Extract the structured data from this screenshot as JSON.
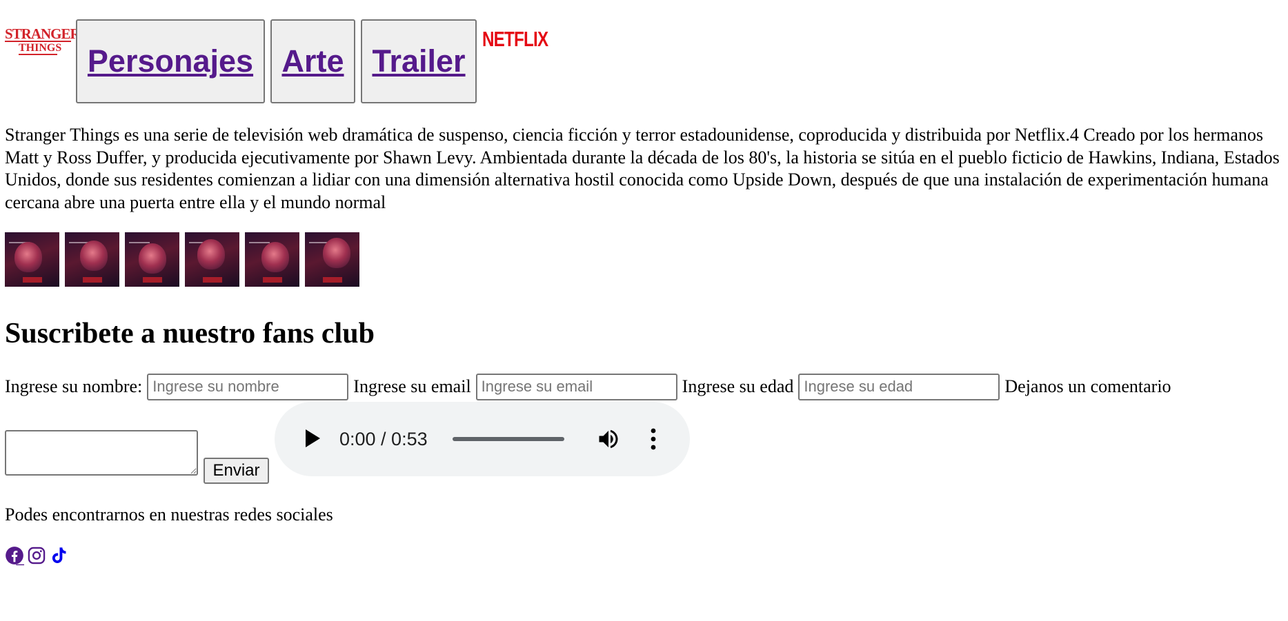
{
  "header": {
    "logo_stranger_line1": "STRANGER",
    "logo_stranger_line2": "THINGS",
    "nav": [
      {
        "label": "Personajes"
      },
      {
        "label": "Arte"
      },
      {
        "label": "Trailer"
      }
    ],
    "logo_netflix": "NETFLIX"
  },
  "intro": {
    "text": "Stranger Things es una serie de televisión web dramática de suspenso, ciencia ficción y terror estadounidense, coproducida y distribuida por Netflix.4 Creado por los hermanos Matt y Ross Duffer, y producida ejecutivamente por Shawn Levy. Ambientada durante la década de los 80's, la historia se sitúa en el pueblo ficticio de Hawkins, Indiana, Estados Unidos, donde sus residentes comienzan a lidiar con una dimensión alternativa hostil conocida como Upside Down, después de que una instalación de experimentación humana cercana abre una puerta entre ella y el mundo normal"
  },
  "gallery": {
    "count": 6
  },
  "subscribe": {
    "title": "Suscribete a nuestro fans club",
    "name_label": "Ingrese su nombre:",
    "name_placeholder": "Ingrese su nombre",
    "email_label": "Ingrese su email",
    "email_placeholder": "Ingrese su email",
    "age_label": "Ingrese su edad",
    "age_placeholder": "Ingrese su edad",
    "comment_label": "Dejanos un comentario",
    "submit_label": "Enviar"
  },
  "audio": {
    "time": "0:00 / 0:53",
    "progress": 0
  },
  "footer": {
    "redes_text": "Podes encontrarnos en nuestras redes sociales",
    "icons": [
      "facebook-icon",
      "instagram-icon",
      "tiktok-icon"
    ]
  },
  "colors": {
    "link_visited": "#551a8b",
    "link": "#0000ee",
    "brand_red": "#e50914",
    "button_bg": "#efefef",
    "audio_bg": "#f1f3f4"
  }
}
